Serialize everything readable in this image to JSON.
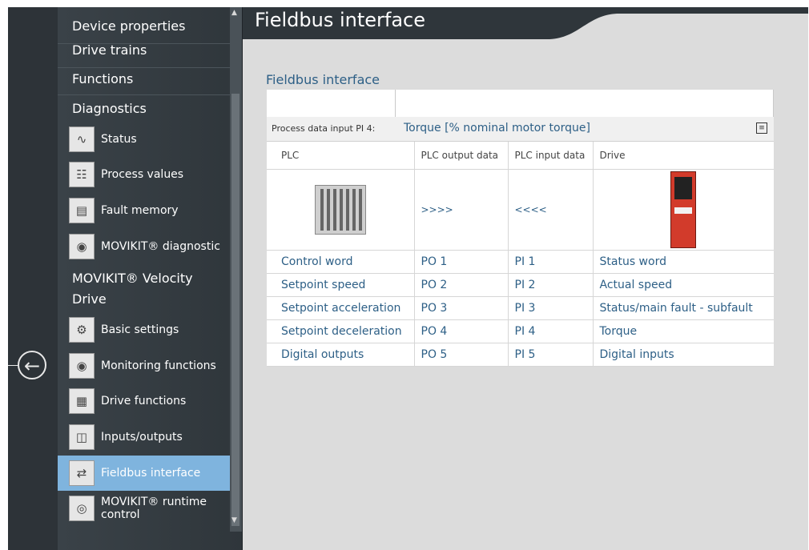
{
  "nav": {
    "sections": [
      "Device properties",
      "Drive trains",
      "Functions",
      "Diagnostics"
    ],
    "diagnostics_items": [
      {
        "label": "Status",
        "icon": "status-icon"
      },
      {
        "label": "Process values",
        "icon": "process-values-icon"
      },
      {
        "label": "Fault memory",
        "icon": "fault-memory-icon"
      },
      {
        "label": "MOVIKIT® diagnostic",
        "icon": "eye-icon"
      }
    ],
    "movikit_section": "MOVIKIT® Velocity Drive",
    "movikit_items": [
      {
        "label": "Basic settings",
        "icon": "basic-settings-icon"
      },
      {
        "label": "Monitoring functions",
        "icon": "eye-icon"
      },
      {
        "label": "Drive functions",
        "icon": "drive-functions-icon"
      },
      {
        "label": "Inputs/outputs",
        "icon": "inputs-outputs-icon"
      },
      {
        "label": "Fieldbus interface",
        "icon": "fieldbus-icon"
      },
      {
        "label": "MOVIKIT® runtime control",
        "icon": "runtime-control-icon"
      }
    ],
    "active_item": "Fieldbus interface"
  },
  "page": {
    "title": "Fieldbus interface",
    "subtitle": "Fieldbus interface"
  },
  "process_data": {
    "label": "Process data input PI 4:",
    "value": "Torque [% nominal motor torque]"
  },
  "table": {
    "headers": [
      "PLC",
      "PLC output data",
      "PLC input data",
      "Drive"
    ],
    "arrows_out": ">>>>",
    "arrows_in": "<<<<",
    "rows": [
      [
        "Control word",
        "PO 1",
        "PI 1",
        "Status word"
      ],
      [
        "Setpoint speed",
        "PO 2",
        "PI 2",
        "Actual speed"
      ],
      [
        "Setpoint acceleration",
        "PO 3",
        "PI 3",
        "Status/main fault - subfault"
      ],
      [
        "Setpoint deceleration",
        "PO 4",
        "PI 4",
        "Torque"
      ],
      [
        "Digital outputs",
        "PO 5",
        "PI 5",
        "Digital inputs"
      ]
    ]
  },
  "colors": {
    "accent": "#2d5f86",
    "active_bg": "#7fb4de",
    "nav_bg": "#343b40"
  }
}
